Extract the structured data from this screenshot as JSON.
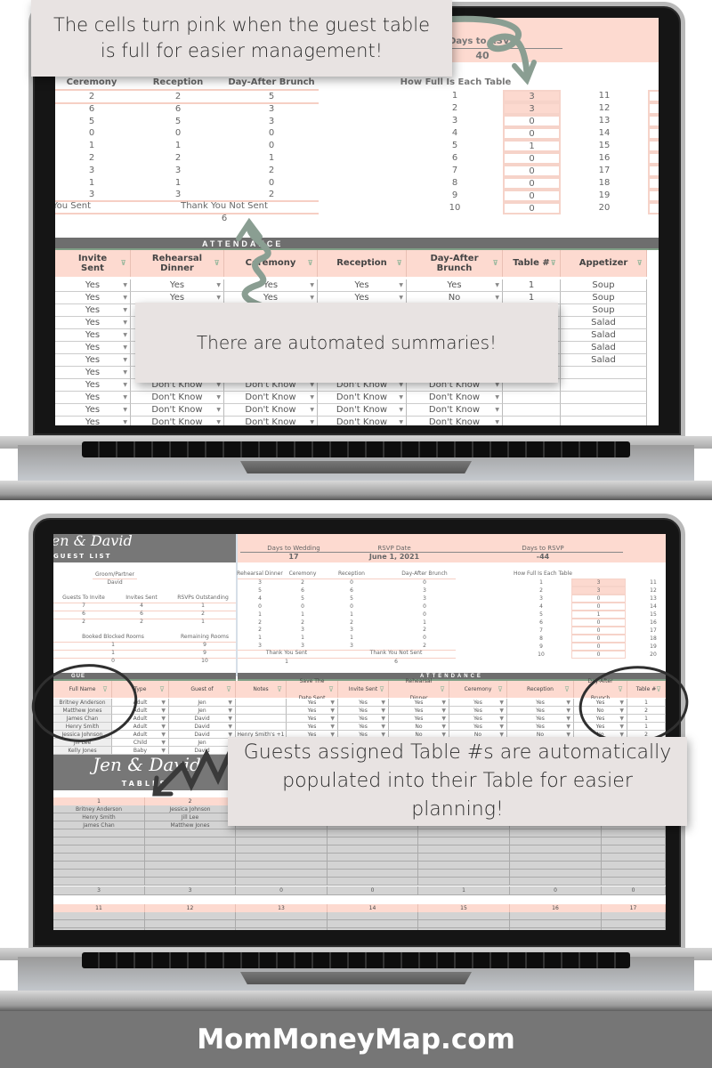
{
  "colors": {
    "pink": "#fddad0",
    "header_gray": "#6e6e6e",
    "arrow_green": "#8a9e92",
    "footer_gray": "#767676"
  },
  "callouts": {
    "full_tables": "The cells turn pink when the guest table is full for easier management!",
    "summaries": "There are automated summaries!",
    "table_assign": "Guests assigned Table #s are automatically populated into their Table for easier planning!"
  },
  "top_screen": {
    "rsvp": {
      "label": "Days to RSVP",
      "value": "40"
    },
    "summary": {
      "headers": [
        "Ceremony",
        "Reception",
        "Day-After Brunch"
      ],
      "rows": [
        [
          2,
          2,
          5
        ],
        [
          6,
          6,
          3
        ],
        [
          5,
          5,
          3
        ],
        [
          0,
          0,
          0
        ],
        [
          1,
          1,
          0
        ],
        [
          2,
          2,
          1
        ],
        [
          3,
          3,
          2
        ],
        [
          1,
          1,
          0
        ],
        [
          3,
          3,
          2
        ]
      ],
      "thank_you_sent_label": "Thank You Sent",
      "thank_you_not_sent_label": "Thank You Not Sent",
      "thank_you_not_sent_value": "6"
    },
    "how_full": {
      "title": "How Full Is Each Table",
      "left": [
        {
          "n": 1,
          "count": 3,
          "full": true
        },
        {
          "n": 2,
          "count": 3,
          "full": true
        },
        {
          "n": 3,
          "count": 0
        },
        {
          "n": 4,
          "count": 0
        },
        {
          "n": 5,
          "count": 1
        },
        {
          "n": 6,
          "count": 0
        },
        {
          "n": 7,
          "count": 0
        },
        {
          "n": 8,
          "count": 0
        },
        {
          "n": 9,
          "count": 0
        },
        {
          "n": 10,
          "count": 0
        }
      ],
      "right": [
        11,
        12,
        13,
        14,
        15,
        16,
        17,
        18,
        19,
        20
      ]
    },
    "attendance": {
      "title": "ATTENDANCE",
      "headers": [
        "Invite Sent",
        "Rehearsal Dinner",
        "Ceremony",
        "Reception",
        "Day-After Brunch",
        "Table #",
        "Appetizer"
      ],
      "rows": [
        [
          "Yes",
          "Yes",
          "Yes",
          "Yes",
          "Yes",
          "1",
          "Soup"
        ],
        [
          "Yes",
          "Yes",
          "Yes",
          "Yes",
          "No",
          "1",
          "Soup"
        ],
        [
          "Yes",
          "",
          "",
          "",
          "",
          "",
          "Soup"
        ],
        [
          "Yes",
          "",
          "",
          "",
          "",
          "",
          "Salad"
        ],
        [
          "Yes",
          "",
          "",
          "",
          "",
          "",
          "Salad"
        ],
        [
          "Yes",
          "",
          "",
          "",
          "",
          "",
          "Salad"
        ],
        [
          "Yes",
          "",
          "",
          "",
          "",
          "",
          "Salad"
        ],
        [
          "Yes",
          "",
          "",
          "",
          "",
          "",
          ""
        ],
        [
          "Yes",
          "Don't Know",
          "Don't Know",
          "Don't Know",
          "Don't Know",
          "",
          ""
        ],
        [
          "Yes",
          "Don't Know",
          "Don't Know",
          "Don't Know",
          "Don't Know",
          "",
          ""
        ],
        [
          "Yes",
          "Don't Know",
          "Don't Know",
          "Don't Know",
          "Don't Know",
          "",
          ""
        ],
        [
          "Yes",
          "Don't Know",
          "Don't Know",
          "Don't Know",
          "Don't Know",
          "",
          ""
        ]
      ]
    }
  },
  "bottom_screen": {
    "title_script": "Jen & David",
    "guest_list_label": "GUEST LIST",
    "stats": [
      {
        "label": "Days to Wedding",
        "value": "17"
      },
      {
        "label": "RSVP Date",
        "value": "June 1, 2021"
      },
      {
        "label": "Days to RSVP",
        "value": "-44"
      }
    ],
    "groom": {
      "label": "Groom/Partner",
      "value": "David"
    },
    "invites": {
      "headers": [
        "Guests To Invite",
        "Invites Sent",
        "RSVPs Outstanding"
      ],
      "rows": [
        [
          7,
          4,
          1
        ],
        [
          6,
          6,
          2
        ],
        [
          2,
          2,
          1
        ]
      ]
    },
    "rooms": {
      "headers": [
        "Booked Blocked Rooms",
        "Remaining Rooms"
      ],
      "rows": [
        [
          1,
          9
        ],
        [
          1,
          9
        ],
        [
          0,
          10
        ]
      ]
    },
    "events": {
      "headers": [
        "Rehearsal Dinner",
        "Ceremony",
        "Reception",
        "Day-After Brunch"
      ],
      "rows": [
        [
          3,
          2,
          0,
          0
        ],
        [
          5,
          6,
          6,
          3
        ],
        [
          4,
          5,
          5,
          3
        ],
        [
          0,
          0,
          0,
          0
        ],
        [
          1,
          1,
          1,
          0
        ],
        [
          2,
          2,
          2,
          1
        ],
        [
          2,
          3,
          3,
          2
        ],
        [
          1,
          1,
          1,
          0
        ],
        [
          3,
          3,
          3,
          2
        ]
      ],
      "thank_you_sent_label": "Thank You Sent",
      "thank_you_sent_value": "1",
      "thank_you_not_sent_label": "Thank You Not Sent",
      "thank_you_not_sent_value": "6"
    },
    "how_full": {
      "title": "How Full Is Each Table",
      "left": [
        {
          "n": 1,
          "count": 3,
          "full": true
        },
        {
          "n": 2,
          "count": 3,
          "full": true
        },
        {
          "n": 3,
          "count": 0
        },
        {
          "n": 4,
          "count": 0
        },
        {
          "n": 5,
          "count": 1
        },
        {
          "n": 6,
          "count": 0
        },
        {
          "n": 7,
          "count": 0
        },
        {
          "n": 8,
          "count": 0
        },
        {
          "n": 9,
          "count": 0
        },
        {
          "n": 10,
          "count": 0
        }
      ],
      "right": [
        11,
        12,
        13,
        14,
        15,
        16,
        17,
        18,
        19,
        20
      ]
    },
    "guest_bar_label": "GUE",
    "attendance_label": "ATTENDANCE",
    "headers": [
      "Full Name",
      "Type",
      "Guest of",
      "Notes",
      "Save The Date Sent",
      "Invite Sent",
      "Rehearsal Dinner",
      "Ceremony",
      "Reception",
      "Day-After Brunch",
      "Table #"
    ],
    "rows": [
      [
        "Britney Anderson",
        "Adult",
        "Jen",
        "",
        "Yes",
        "Yes",
        "Yes",
        "Yes",
        "Yes",
        "Yes",
        "1"
      ],
      [
        "Matthew Jones",
        "Adult",
        "Jen",
        "",
        "Yes",
        "Yes",
        "Yes",
        "Yes",
        "Yes",
        "No",
        "2"
      ],
      [
        "James Chan",
        "Adult",
        "David",
        "",
        "Yes",
        "Yes",
        "Yes",
        "Yes",
        "Yes",
        "Yes",
        "1"
      ],
      [
        "Henry Smith",
        "Adult",
        "David",
        "",
        "Yes",
        "Yes",
        "No",
        "Yes",
        "Yes",
        "Yes",
        "1"
      ],
      [
        "Jessica Johnson",
        "Adult",
        "David",
        "Henry Smith's +1",
        "Yes",
        "Yes",
        "No",
        "No",
        "No",
        "No",
        "2"
      ],
      [
        "Jill Lee",
        "Child",
        "Jen",
        "",
        "",
        "",
        "",
        "",
        "",
        "",
        ""
      ],
      [
        "Kelly Jones",
        "Baby",
        "David",
        "",
        "",
        "",
        "",
        "",
        "",
        "",
        ""
      ]
    ],
    "tables_section": {
      "title_script": "Jen & David",
      "label": "TABLES",
      "first_row_numbers": [
        1,
        2,
        3,
        4,
        5,
        6,
        7
      ],
      "assignments": [
        [
          "Britney Anderson",
          "Henry Smith",
          "James Chan"
        ],
        [
          "Jessica Johnson",
          "Jill Lee",
          "Matthew Jones"
        ],
        [],
        [],
        [],
        [],
        []
      ],
      "counts": [
        3,
        3,
        0,
        0,
        1,
        0,
        0
      ],
      "second_row_numbers": [
        11,
        12,
        13,
        14,
        15,
        16,
        17
      ]
    }
  },
  "footer": {
    "site": "MomMoneyMap.com"
  }
}
